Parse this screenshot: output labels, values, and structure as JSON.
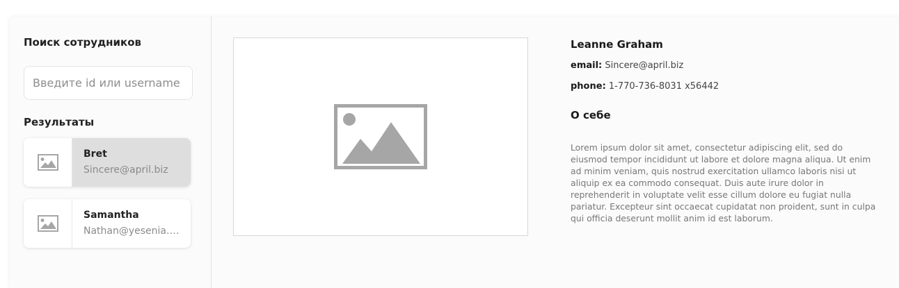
{
  "sidebar": {
    "title": "Поиск сотрудников",
    "search_placeholder": "Введите id или username",
    "results_title": "Результаты",
    "results": [
      {
        "name": "Bret",
        "email": "Sincere@april.biz",
        "active": true
      },
      {
        "name": "Samantha",
        "email": "Nathan@yesenia.net",
        "active": false
      }
    ]
  },
  "profile": {
    "photo_icon": "image-placeholder-icon",
    "name": "Leanne Graham",
    "email_label": "email:",
    "email": "Sincere@april.biz",
    "phone_label": "phone:",
    "phone": "1-770-736-8031 x56442",
    "about_title": "О себе",
    "about_text": "Lorem ipsum dolor sit amet, consectetur adipiscing elit, sed do eiusmod tempor incididunt ut labore et dolore magna aliqua. Ut enim ad minim veniam, quis nostrud exercitation ullamco laboris nisi ut aliquip ex ea commodo consequat. Duis aute irure dolor in reprehenderit in voluptate velit esse cillum dolore eu fugiat nulla pariatur. Excepteur sint occaecat cupidatat non proident, sunt in culpa qui officia deserunt mollit anim id est laborum."
  },
  "colors": {
    "active_result": "#dedede",
    "placeholder_icon": "#a6a6a6"
  }
}
